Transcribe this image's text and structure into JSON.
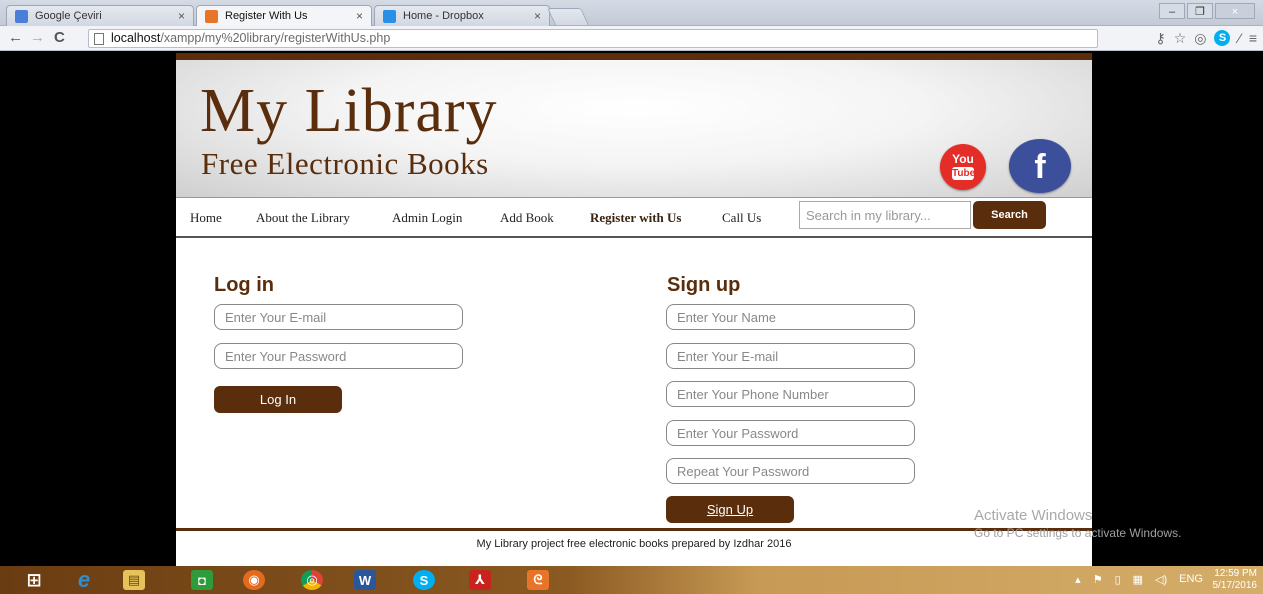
{
  "browser": {
    "tabs": [
      {
        "label": "Google Çeviri",
        "favicon_color": "#4a7fd8",
        "active": false
      },
      {
        "label": "Register With Us",
        "favicon_color": "#e8742a",
        "active": true
      },
      {
        "label": "Home - Dropbox",
        "favicon_color": "#2a8fe6",
        "active": false
      }
    ],
    "close_glyph": "×",
    "url_host": "localhost",
    "url_path": "/xampp/my%20library/registerWithUs.php",
    "window_buttons": [
      "–",
      "❐",
      "×"
    ]
  },
  "site": {
    "title": "My Library",
    "subtitle": "Free Electronic Books",
    "youtube": {
      "top": "You",
      "bottom": "Tube"
    },
    "facebook": "f",
    "brand_color": "#5a2d0c"
  },
  "nav": {
    "items": [
      {
        "label": "Home",
        "active": false
      },
      {
        "label": "About the Library",
        "active": false
      },
      {
        "label": "Admin Login",
        "active": false
      },
      {
        "label": "Add Book",
        "active": false
      },
      {
        "label": "Register with Us",
        "active": true
      },
      {
        "label": "Call Us",
        "active": false
      }
    ],
    "search_placeholder": "Search in my library...",
    "search_button": "Search"
  },
  "login": {
    "title": "Log in",
    "email_placeholder": "Enter Your E-mail",
    "password_placeholder": "Enter Your Password",
    "button": "Log In"
  },
  "signup": {
    "title": "Sign up",
    "name_placeholder": "Enter Your Name",
    "email_placeholder": "Enter Your E-mail",
    "phone_placeholder": "Enter Your Phone Number",
    "password_placeholder": "Enter Your Password",
    "repeat_placeholder": "Repeat Your Password",
    "button": "Sign Up"
  },
  "footer": {
    "text": "My Library project free electronic books prepared by Izdhar 2016"
  },
  "watermark": {
    "line1": "Activate Windows",
    "line2": "Go to PC settings to activate Windows."
  },
  "taskbar": {
    "apps": [
      {
        "name": "windows-start-icon",
        "glyph": "⊞",
        "color": "#ffffff"
      },
      {
        "name": "internet-explorer-icon",
        "glyph": "e",
        "color": "#2b8fd6"
      },
      {
        "name": "file-explorer-icon",
        "glyph": "▤",
        "color": "#e6c25a"
      },
      {
        "name": "store-icon",
        "glyph": "◘",
        "color": "#2e9c3a"
      },
      {
        "name": "firefox-icon",
        "glyph": "◉",
        "color": "#e66a1e"
      },
      {
        "name": "chrome-icon",
        "glyph": "◎",
        "color": "#3a9d3a"
      },
      {
        "name": "word-icon",
        "glyph": "W",
        "color": "#2b579a"
      },
      {
        "name": "skype-icon",
        "glyph": "S",
        "color": "#00aff0"
      },
      {
        "name": "acrobat-icon",
        "glyph": "⅄",
        "color": "#c8231c"
      },
      {
        "name": "xampp-icon",
        "glyph": "ᘓ",
        "color": "#e8742a"
      }
    ],
    "language": "ENG",
    "time": "12:59 PM",
    "date": "5/17/2016"
  }
}
